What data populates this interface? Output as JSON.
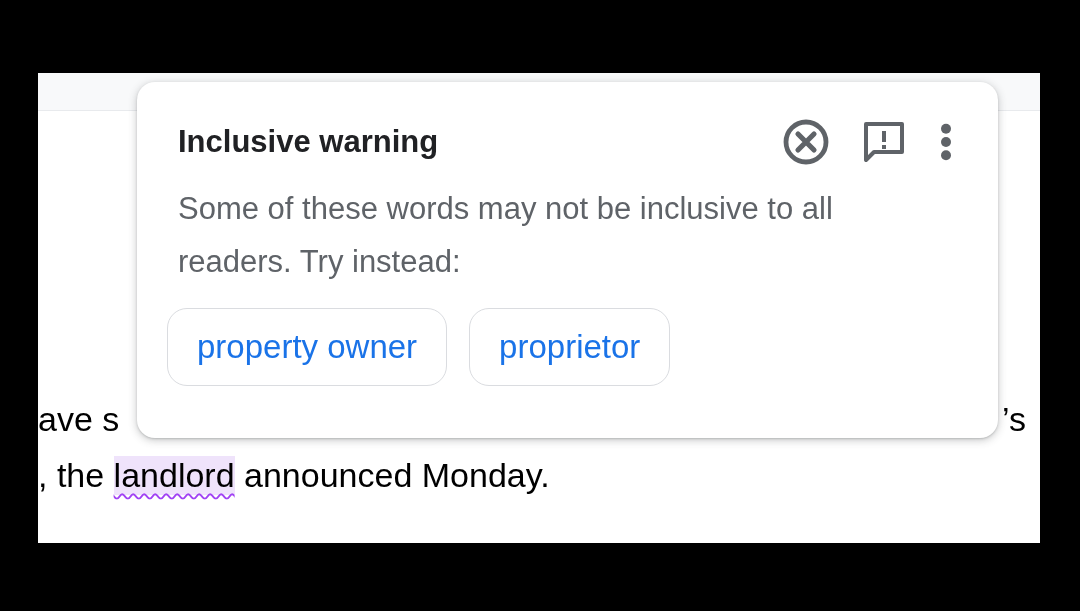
{
  "document": {
    "line_1": {
      "left": "ave s",
      "right": "’s"
    },
    "line_2": {
      "before": ", the ",
      "flagged": "landlord",
      "after": " announced Monday."
    }
  },
  "popup": {
    "title": "Inclusive warning",
    "message": "Some of these words may not be inclusive to all readers. Try instead:",
    "suggestions": [
      "property owner",
      "proprietor"
    ]
  }
}
